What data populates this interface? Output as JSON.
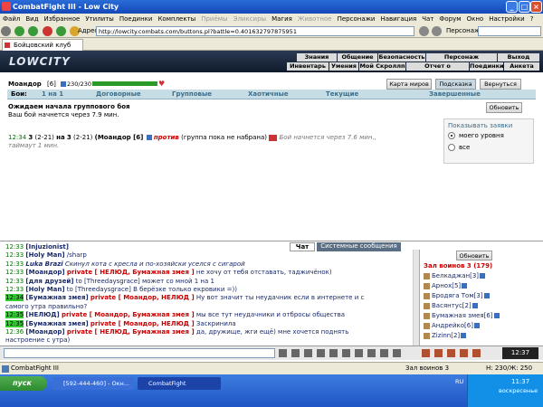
{
  "window": {
    "title": "CombatFight III - Low City",
    "controls": [
      "_",
      "□",
      "×"
    ]
  },
  "menu": [
    "Файл",
    "Вид",
    "Избранное",
    "Утилиты",
    "Поединки",
    "Комплекты",
    "Приёмы",
    "Эликсиры",
    "Магия",
    "Животное",
    "Персонажи",
    "Навигация",
    "Чат",
    "Форум",
    "Окно",
    "Настройки",
    "?"
  ],
  "menu_disabled": [
    "Приёмы",
    "Эликсиры",
    "Животное"
  ],
  "address": {
    "label": "Адрес:",
    "url": "http://lowcity.combats.com/buttons.pl?battle=0.4016327978759​51",
    "persona_label": "Персонаж:"
  },
  "tab": {
    "label": "Бойцовский клуб"
  },
  "banner": {
    "logo": "LOWCITY",
    "nav_top": [
      "Знания",
      "Общение",
      "Безопасность",
      "Персонаж",
      "Выход"
    ],
    "nav_bottom": [
      "Инвентарь",
      "Умения",
      "Мой Скроллп",
      "Отчет о переводах",
      "Поединки",
      "Анкета"
    ]
  },
  "player": {
    "name": "Моандор",
    "level": "[6]",
    "hp": "230/230",
    "hp_fraction": 1.0
  },
  "buttons": {
    "map": "Карта миров",
    "hint": "Подсказка",
    "back": "Вернуться",
    "refresh": "Обновить"
  },
  "fight_types": {
    "label": "Бои:",
    "items": [
      "1 на 1",
      "Договорные",
      "Групповые",
      "Хаотичные",
      "Текущие",
      "Завершенные"
    ]
  },
  "status": {
    "heading": "Ожидаем начала группового боя",
    "sub": "Ваш бой начнется через 7.9 мин."
  },
  "show_requests": {
    "title": "Показывать заявки",
    "options": [
      "моего уровня",
      "все"
    ],
    "selected": 0
  },
  "battle": {
    "time": "12:34",
    "count": "3",
    "ratio1": "(2-21)",
    "on": "на",
    "count2": "3",
    "ratio2": "(2-21)",
    "player": "(Моандор [6]",
    "vs": "против",
    "group": "(группа пока не набрана)",
    "starts": "Бой начнется через 7.6 мин.,",
    "timeout": "таймаут 1 мин."
  },
  "chat_tabs": [
    "Чат",
    "Системные сообщения"
  ],
  "chat": [
    {
      "time": "12:33",
      "hl": false,
      "nick": "[Injuzionist]",
      "priv": "",
      "text": "",
      "italic": false
    },
    {
      "time": "12:33",
      "hl": false,
      "nick": "[Holy Man]",
      "priv": "",
      "text": "/sharp",
      "italic": false
    },
    {
      "time": "12:33",
      "hl": false,
      "nick": "Luka Brazi",
      "priv": "",
      "text": "Скинул кота с кресла и по-хозяйски уселся с сигарой",
      "italic": true
    },
    {
      "time": "12:33",
      "hl": false,
      "nick": "[Моандор]",
      "priv": "private [ НЕЛЮД, Бумажная змея ]",
      "text": "не хочу от тебя отставать, таджичёнок)",
      "italic": false
    },
    {
      "time": "12:33",
      "hl": false,
      "nick": "[для друзей]",
      "priv": "",
      "text": "to [Threedaysgrace] может со мной 1 на 1",
      "italic": false
    },
    {
      "time": "12:33",
      "hl": false,
      "nick": "[Holy Man]",
      "priv": "",
      "text": "to [Threedaysgrace] В берёзке только екровики =))",
      "italic": false
    },
    {
      "time": "12:34",
      "hl": true,
      "nick": "[Бумажная змея]",
      "priv": "private [ Моандор, НЕЛЮД ]",
      "text": "Ну вот значит ты неудачник если в интернете и с",
      "italic": false
    },
    {
      "time": "",
      "hl": false,
      "nick": "",
      "priv": "",
      "text": "самого утра правильно?",
      "italic": false
    },
    {
      "time": "12:35",
      "hl": true,
      "nick": "[НЕЛЮД]",
      "priv": "private [ Моандор, Бумажная змея ]",
      "text": "мы все тут неудачники и отбросы общества",
      "italic": false
    },
    {
      "time": "12:35",
      "hl": true,
      "nick": "[Бумажная змея]",
      "priv": "private [ Моандор, НЕЛЮД ]",
      "text": "Заскринила",
      "italic": false
    },
    {
      "time": "12:36",
      "hl": false,
      "nick": "[Моандор]",
      "priv": "private [ НЕЛЮД, Бумажная змея ]",
      "text": "да, дружище, жги ещё) мне хочется поднять",
      "italic": false
    },
    {
      "time": "",
      "hl": false,
      "nick": "",
      "priv": "",
      "text": "настроение с утра)",
      "italic": false
    }
  ],
  "users_panel": {
    "refresh": "Обновить",
    "room": "Зал воинов 3",
    "count": "(179)",
    "users": [
      {
        "name": "Белкаджан",
        "level": "[3]"
      },
      {
        "name": "Арнох",
        "level": "[5]"
      },
      {
        "name": "Бродяга Том",
        "level": "[3]"
      },
      {
        "name": "Васянтус",
        "level": "[2]"
      },
      {
        "name": "Бумажная змея",
        "level": "[6]"
      },
      {
        "name": "Андрейко",
        "level": "[6]"
      },
      {
        "name": "Zizinn",
        "level": "[2]"
      }
    ]
  },
  "statusbar": {
    "app": "CombatFight III",
    "room": "Зал воинов 3",
    "hp": "Н: 230/Ж: 250",
    "clock": "12:37"
  },
  "taskbar": {
    "start": "пуск",
    "tasks": [
      "[592-444-460] - Окн...",
      "CombatFight"
    ],
    "lang": "RU",
    "time": "11:37",
    "day": "воскресенье"
  }
}
